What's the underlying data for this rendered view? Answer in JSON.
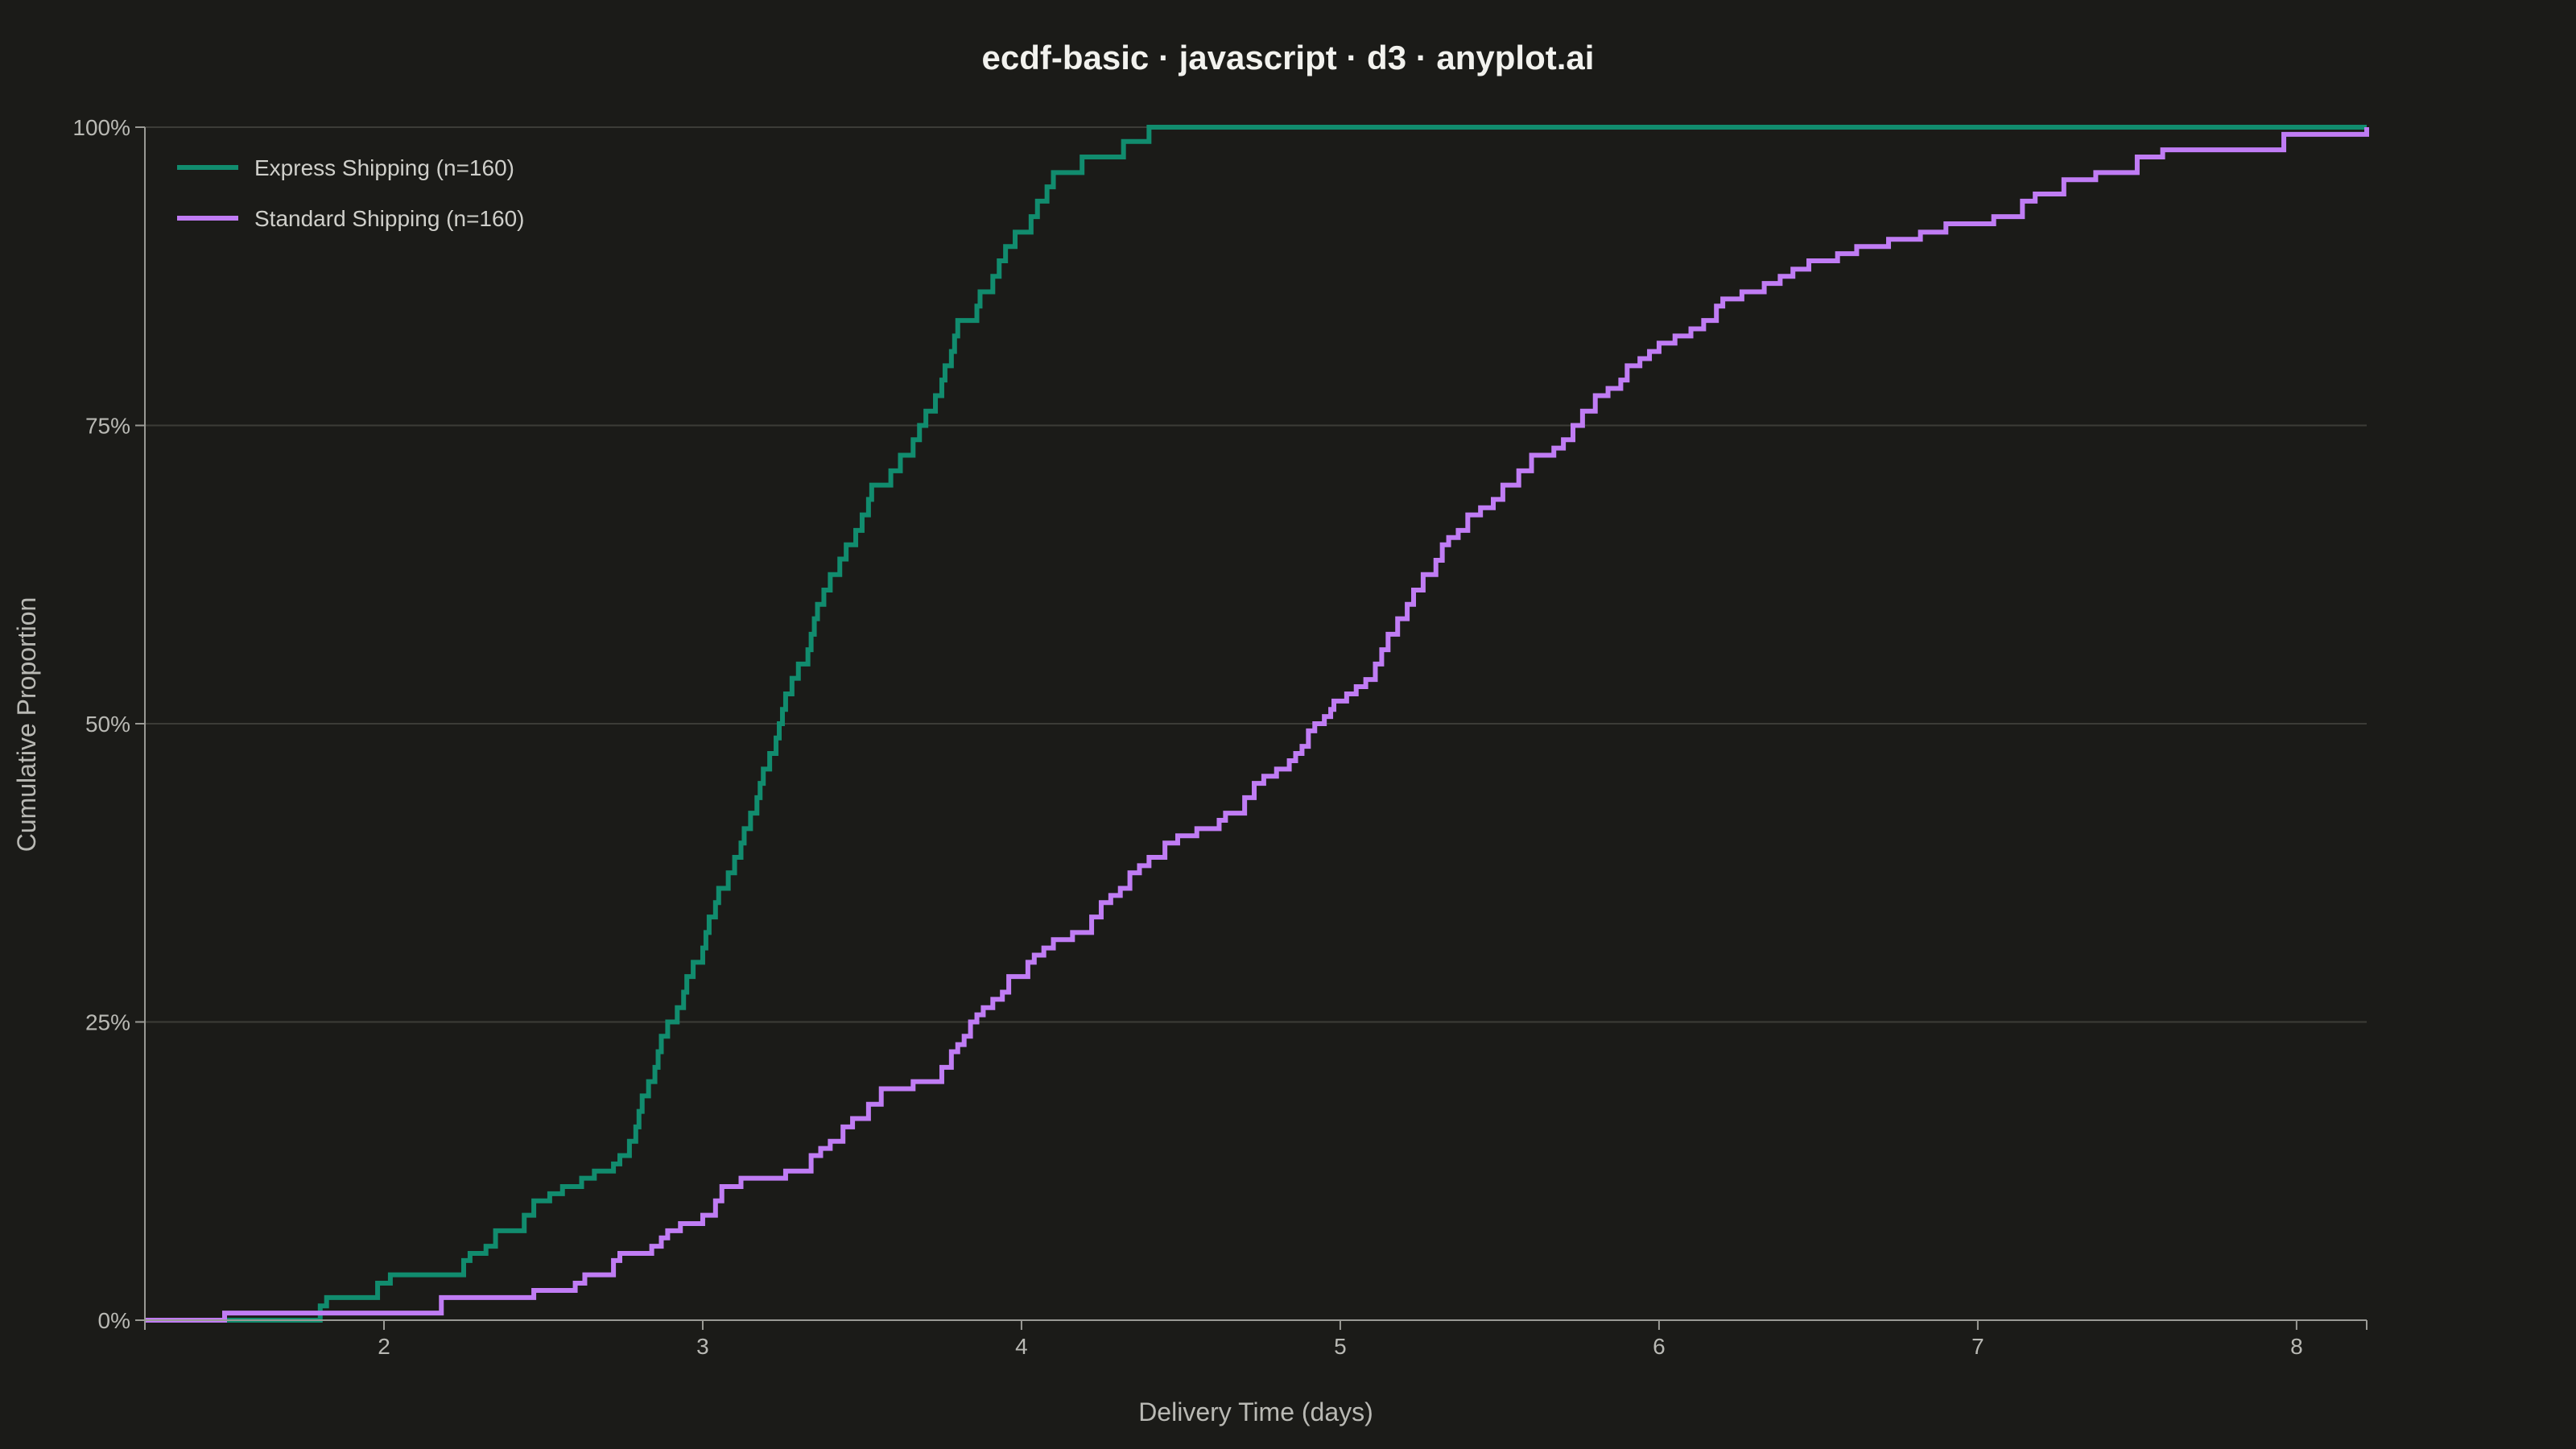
{
  "chart_data": {
    "type": "line",
    "title": "ecdf-basic · javascript · d3 · anyplot.ai",
    "xlabel": "Delivery Time (days)",
    "ylabel": "Cumulative Proportion",
    "xlim": [
      1.25,
      8.22
    ],
    "ylim": [
      0,
      1
    ],
    "x_ticks": [
      2,
      3,
      4,
      5,
      6,
      7,
      8
    ],
    "y_ticks": [
      0,
      0.25,
      0.5,
      0.75,
      1
    ],
    "y_tick_labels": [
      "0%",
      "25%",
      "50%",
      "75%",
      "100%"
    ],
    "grid": "horizontal",
    "legend_position": "top-left",
    "series": [
      {
        "name": "Express Shipping (n=160)",
        "color": "#118c6e",
        "points": [
          [
            1.25,
            0.0
          ],
          [
            1.58,
            0.0
          ],
          [
            1.8,
            0.012
          ],
          [
            1.82,
            0.019
          ],
          [
            1.98,
            0.031
          ],
          [
            2.02,
            0.038
          ],
          [
            2.25,
            0.05
          ],
          [
            2.27,
            0.056
          ],
          [
            2.32,
            0.062
          ],
          [
            2.35,
            0.075
          ],
          [
            2.44,
            0.088
          ],
          [
            2.47,
            0.1
          ],
          [
            2.52,
            0.106
          ],
          [
            2.56,
            0.112
          ],
          [
            2.62,
            0.119
          ],
          [
            2.66,
            0.125
          ],
          [
            2.72,
            0.131
          ],
          [
            2.74,
            0.138
          ],
          [
            2.77,
            0.15
          ],
          [
            2.79,
            0.162
          ],
          [
            2.8,
            0.175
          ],
          [
            2.81,
            0.188
          ],
          [
            2.83,
            0.2
          ],
          [
            2.85,
            0.212
          ],
          [
            2.86,
            0.225
          ],
          [
            2.87,
            0.238
          ],
          [
            2.89,
            0.25
          ],
          [
            2.92,
            0.262
          ],
          [
            2.94,
            0.275
          ],
          [
            2.95,
            0.288
          ],
          [
            2.97,
            0.3
          ],
          [
            3.0,
            0.312
          ],
          [
            3.01,
            0.325
          ],
          [
            3.02,
            0.338
          ],
          [
            3.04,
            0.35
          ],
          [
            3.05,
            0.362
          ],
          [
            3.08,
            0.375
          ],
          [
            3.1,
            0.388
          ],
          [
            3.12,
            0.4
          ],
          [
            3.13,
            0.412
          ],
          [
            3.15,
            0.425
          ],
          [
            3.17,
            0.438
          ],
          [
            3.18,
            0.45
          ],
          [
            3.19,
            0.462
          ],
          [
            3.21,
            0.475
          ],
          [
            3.23,
            0.488
          ],
          [
            3.24,
            0.5
          ],
          [
            3.25,
            0.512
          ],
          [
            3.26,
            0.525
          ],
          [
            3.28,
            0.538
          ],
          [
            3.3,
            0.55
          ],
          [
            3.33,
            0.562
          ],
          [
            3.34,
            0.575
          ],
          [
            3.35,
            0.588
          ],
          [
            3.36,
            0.6
          ],
          [
            3.38,
            0.612
          ],
          [
            3.4,
            0.625
          ],
          [
            3.43,
            0.638
          ],
          [
            3.45,
            0.65
          ],
          [
            3.48,
            0.662
          ],
          [
            3.5,
            0.675
          ],
          [
            3.52,
            0.688
          ],
          [
            3.53,
            0.7
          ],
          [
            3.59,
            0.712
          ],
          [
            3.62,
            0.725
          ],
          [
            3.66,
            0.738
          ],
          [
            3.68,
            0.75
          ],
          [
            3.7,
            0.762
          ],
          [
            3.73,
            0.775
          ],
          [
            3.75,
            0.788
          ],
          [
            3.76,
            0.8
          ],
          [
            3.78,
            0.812
          ],
          [
            3.79,
            0.825
          ],
          [
            3.8,
            0.838
          ],
          [
            3.86,
            0.85
          ],
          [
            3.87,
            0.862
          ],
          [
            3.91,
            0.875
          ],
          [
            3.93,
            0.888
          ],
          [
            3.95,
            0.9
          ],
          [
            3.98,
            0.912
          ],
          [
            4.03,
            0.925
          ],
          [
            4.05,
            0.938
          ],
          [
            4.08,
            0.95
          ],
          [
            4.1,
            0.962
          ],
          [
            4.19,
            0.975
          ],
          [
            4.32,
            0.988
          ],
          [
            4.4,
            1.0
          ],
          [
            8.22,
            1.0
          ]
        ]
      },
      {
        "name": "Standard Shipping (n=160)",
        "color": "#c07cf4",
        "points": [
          [
            1.25,
            0.0
          ],
          [
            1.5,
            0.006
          ],
          [
            2.18,
            0.019
          ],
          [
            2.47,
            0.025
          ],
          [
            2.6,
            0.031
          ],
          [
            2.63,
            0.038
          ],
          [
            2.72,
            0.05
          ],
          [
            2.74,
            0.056
          ],
          [
            2.84,
            0.062
          ],
          [
            2.87,
            0.069
          ],
          [
            2.89,
            0.075
          ],
          [
            2.93,
            0.081
          ],
          [
            3.0,
            0.088
          ],
          [
            3.04,
            0.1
          ],
          [
            3.06,
            0.112
          ],
          [
            3.12,
            0.119
          ],
          [
            3.26,
            0.125
          ],
          [
            3.34,
            0.138
          ],
          [
            3.37,
            0.144
          ],
          [
            3.4,
            0.15
          ],
          [
            3.44,
            0.162
          ],
          [
            3.47,
            0.169
          ],
          [
            3.52,
            0.181
          ],
          [
            3.56,
            0.194
          ],
          [
            3.66,
            0.2
          ],
          [
            3.75,
            0.212
          ],
          [
            3.78,
            0.225
          ],
          [
            3.8,
            0.231
          ],
          [
            3.82,
            0.238
          ],
          [
            3.84,
            0.25
          ],
          [
            3.86,
            0.256
          ],
          [
            3.88,
            0.262
          ],
          [
            3.91,
            0.269
          ],
          [
            3.94,
            0.275
          ],
          [
            3.96,
            0.288
          ],
          [
            4.02,
            0.3
          ],
          [
            4.04,
            0.306
          ],
          [
            4.07,
            0.312
          ],
          [
            4.1,
            0.319
          ],
          [
            4.16,
            0.325
          ],
          [
            4.22,
            0.338
          ],
          [
            4.25,
            0.35
          ],
          [
            4.28,
            0.356
          ],
          [
            4.31,
            0.362
          ],
          [
            4.34,
            0.375
          ],
          [
            4.37,
            0.381
          ],
          [
            4.4,
            0.388
          ],
          [
            4.45,
            0.4
          ],
          [
            4.49,
            0.406
          ],
          [
            4.55,
            0.412
          ],
          [
            4.62,
            0.419
          ],
          [
            4.64,
            0.425
          ],
          [
            4.7,
            0.438
          ],
          [
            4.73,
            0.45
          ],
          [
            4.76,
            0.456
          ],
          [
            4.8,
            0.462
          ],
          [
            4.84,
            0.469
          ],
          [
            4.86,
            0.475
          ],
          [
            4.88,
            0.481
          ],
          [
            4.9,
            0.494
          ],
          [
            4.92,
            0.5
          ],
          [
            4.95,
            0.506
          ],
          [
            4.97,
            0.512
          ],
          [
            4.98,
            0.519
          ],
          [
            5.02,
            0.525
          ],
          [
            5.05,
            0.531
          ],
          [
            5.08,
            0.537
          ],
          [
            5.11,
            0.55
          ],
          [
            5.13,
            0.562
          ],
          [
            5.15,
            0.575
          ],
          [
            5.18,
            0.588
          ],
          [
            5.21,
            0.6
          ],
          [
            5.23,
            0.612
          ],
          [
            5.26,
            0.625
          ],
          [
            5.3,
            0.637
          ],
          [
            5.32,
            0.65
          ],
          [
            5.34,
            0.656
          ],
          [
            5.37,
            0.662
          ],
          [
            5.4,
            0.675
          ],
          [
            5.44,
            0.681
          ],
          [
            5.48,
            0.688
          ],
          [
            5.51,
            0.7
          ],
          [
            5.56,
            0.712
          ],
          [
            5.6,
            0.725
          ],
          [
            5.67,
            0.731
          ],
          [
            5.7,
            0.738
          ],
          [
            5.73,
            0.75
          ],
          [
            5.76,
            0.762
          ],
          [
            5.8,
            0.775
          ],
          [
            5.84,
            0.781
          ],
          [
            5.88,
            0.788
          ],
          [
            5.9,
            0.8
          ],
          [
            5.94,
            0.806
          ],
          [
            5.97,
            0.812
          ],
          [
            6.0,
            0.819
          ],
          [
            6.05,
            0.825
          ],
          [
            6.1,
            0.831
          ],
          [
            6.14,
            0.838
          ],
          [
            6.18,
            0.85
          ],
          [
            6.2,
            0.856
          ],
          [
            6.26,
            0.862
          ],
          [
            6.33,
            0.869
          ],
          [
            6.38,
            0.875
          ],
          [
            6.42,
            0.881
          ],
          [
            6.47,
            0.888
          ],
          [
            6.56,
            0.894
          ],
          [
            6.62,
            0.9
          ],
          [
            6.72,
            0.906
          ],
          [
            6.82,
            0.912
          ],
          [
            6.9,
            0.919
          ],
          [
            7.05,
            0.925
          ],
          [
            7.14,
            0.938
          ],
          [
            7.18,
            0.944
          ],
          [
            7.27,
            0.956
          ],
          [
            7.37,
            0.962
          ],
          [
            7.5,
            0.975
          ],
          [
            7.58,
            0.981
          ],
          [
            7.96,
            0.994
          ],
          [
            8.22,
            1.0
          ]
        ]
      }
    ]
  }
}
